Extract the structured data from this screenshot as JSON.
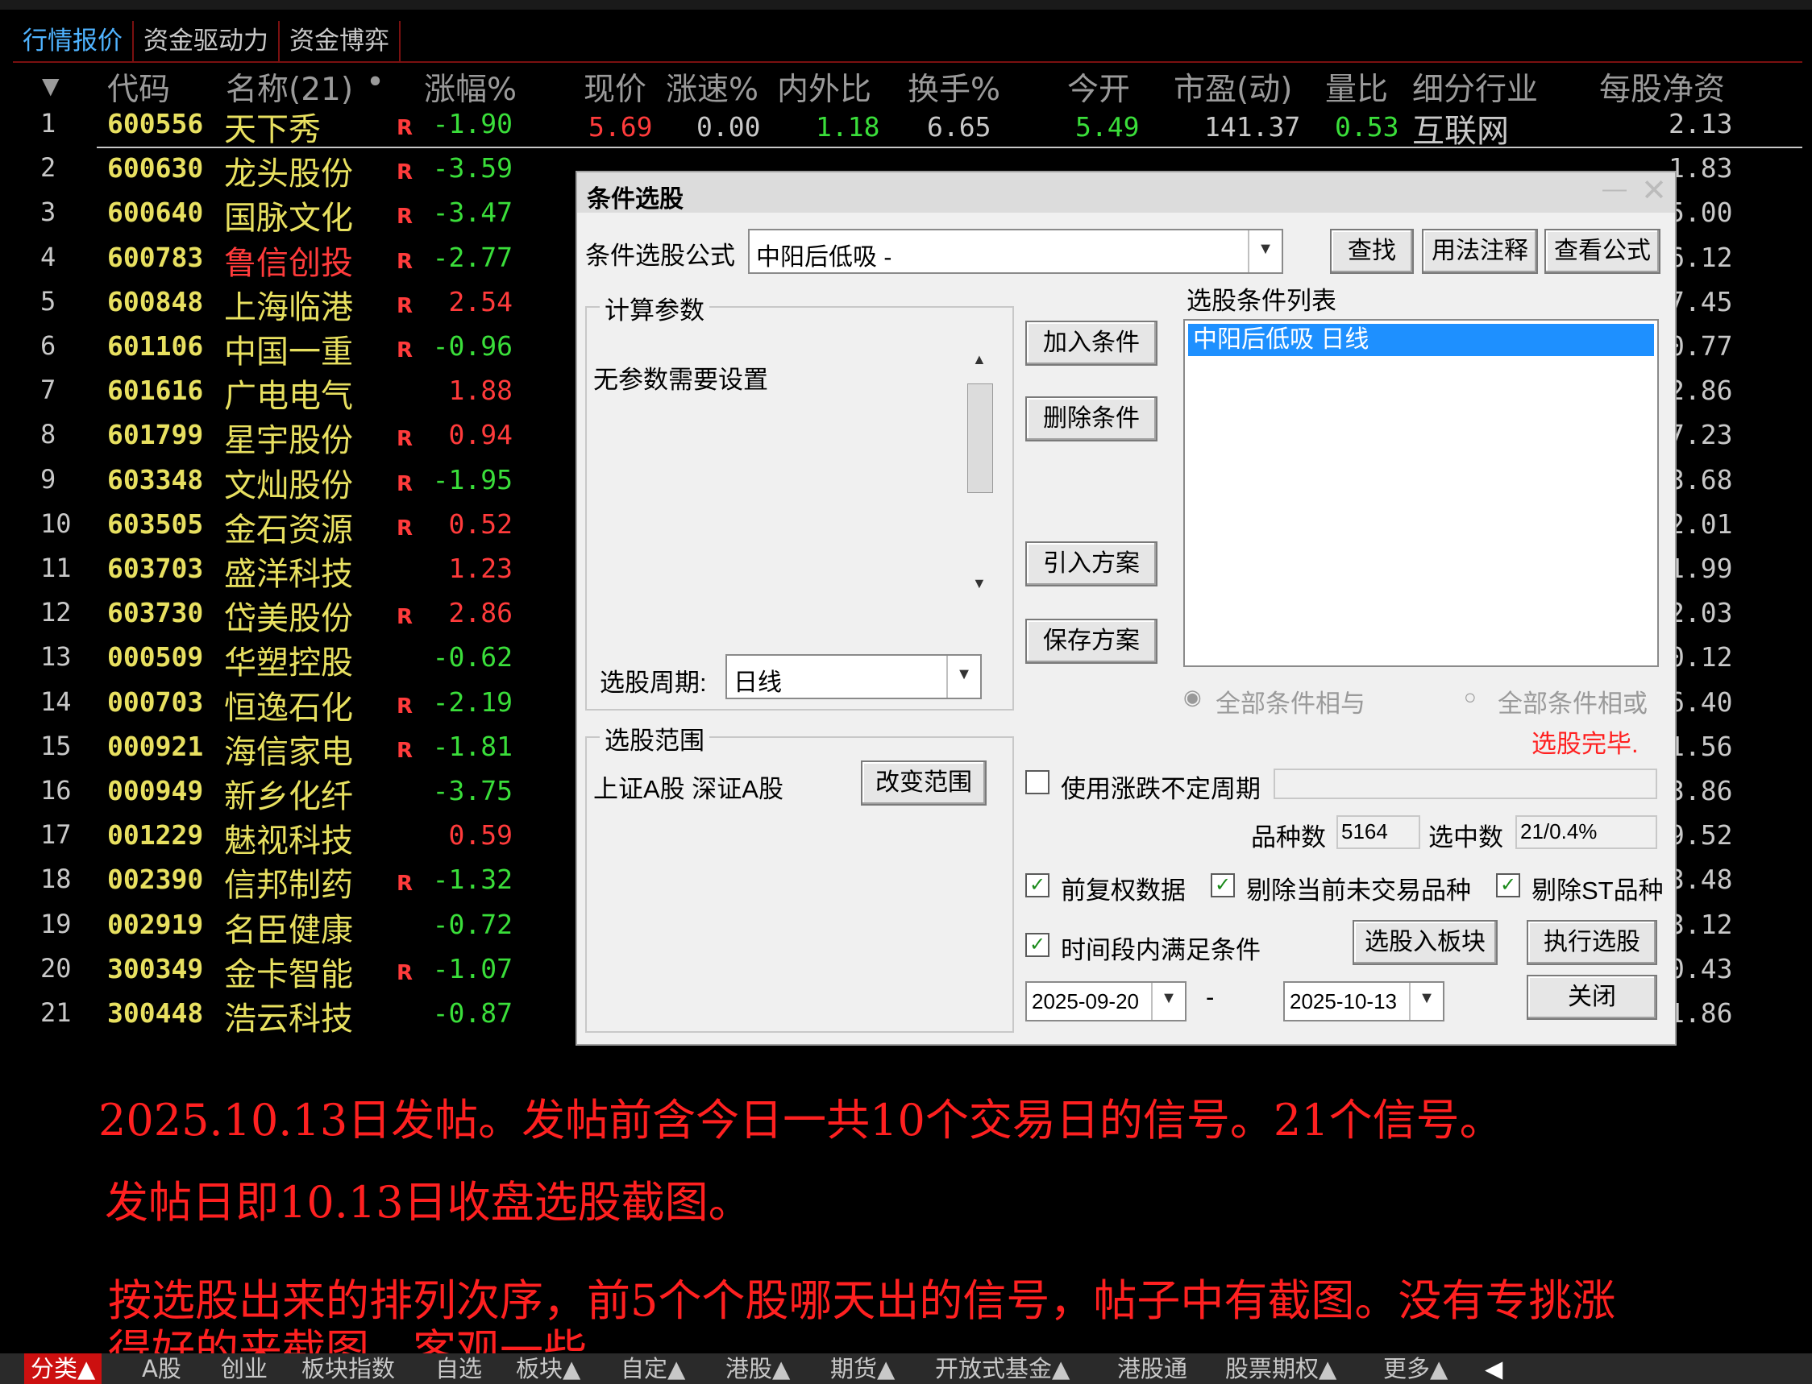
{
  "tabs": [
    "行情报价",
    "资金驱动力",
    "资金博弈"
  ],
  "columns": {
    "sort_icon": "▼",
    "code": "代码",
    "name": "名称(21)",
    "dot": "•",
    "change": "涨幅%",
    "price": "现价",
    "speed": "涨速%",
    "inout": "内外比",
    "turnover": "换手%",
    "open": "今开",
    "pe": "市盈(动)",
    "volratio": "量比",
    "industry": "细分行业",
    "nav": "每股净资"
  },
  "first_row_extra": {
    "price": "5.69",
    "speed": "0.00",
    "inout": "1.18",
    "turnover": "6.65",
    "open": "5.49",
    "pe": "141.37",
    "volratio": "0.53",
    "industry": "互联网"
  },
  "rows": [
    {
      "n": "1",
      "code": "600556",
      "name": "天下秀",
      "r": "R",
      "pct": "-1.90",
      "nav": "2.13"
    },
    {
      "n": "2",
      "code": "600630",
      "name": "龙头股份",
      "r": "R",
      "pct": "-3.59",
      "nav": "1.83"
    },
    {
      "n": "3",
      "code": "600640",
      "name": "国脉文化",
      "r": "R",
      "pct": "-3.47",
      "nav": "5.00"
    },
    {
      "n": "4",
      "code": "600783",
      "name": "鲁信创投",
      "r": "R",
      "pct": "-2.77",
      "nav": "6.12"
    },
    {
      "n": "5",
      "code": "600848",
      "name": "上海临港",
      "r": "R",
      "pct": "2.54",
      "nav": "7.45"
    },
    {
      "n": "6",
      "code": "601106",
      "name": "中国一重",
      "r": "R",
      "pct": "-0.96",
      "nav": "0.77"
    },
    {
      "n": "7",
      "code": "601616",
      "name": "广电电气",
      "r": "",
      "pct": "1.88",
      "nav": "2.86"
    },
    {
      "n": "8",
      "code": "601799",
      "name": "星宇股份",
      "r": "R",
      "pct": "0.94",
      "nav": "7.23"
    },
    {
      "n": "9",
      "code": "603348",
      "name": "文灿股份",
      "r": "R",
      "pct": "-1.95",
      "nav": "3.68"
    },
    {
      "n": "10",
      "code": "603505",
      "name": "金石资源",
      "r": "R",
      "pct": "0.52",
      "nav": "2.01"
    },
    {
      "n": "11",
      "code": "603703",
      "name": "盛洋科技",
      "r": "",
      "pct": "1.23",
      "nav": "1.99"
    },
    {
      "n": "12",
      "code": "603730",
      "name": "岱美股份",
      "r": "R",
      "pct": "2.86",
      "nav": "2.03"
    },
    {
      "n": "13",
      "code": "000509",
      "name": "华塑控股",
      "r": "",
      "pct": "-0.62",
      "nav": "0.12"
    },
    {
      "n": "14",
      "code": "000703",
      "name": "恒逸石化",
      "r": "R",
      "pct": "-2.19",
      "nav": "6.40"
    },
    {
      "n": "15",
      "code": "000921",
      "name": "海信家电",
      "r": "R",
      "pct": "-1.81",
      "nav": "1.56"
    },
    {
      "n": "16",
      "code": "000949",
      "name": "新乡化纤",
      "r": "",
      "pct": "-3.75",
      "nav": "3.86"
    },
    {
      "n": "17",
      "code": "001229",
      "name": "魅视科技",
      "r": "",
      "pct": "0.59",
      "nav": "9.52"
    },
    {
      "n": "18",
      "code": "002390",
      "name": "信邦制药",
      "r": "R",
      "pct": "-1.32",
      "nav": "3.48"
    },
    {
      "n": "19",
      "code": "002919",
      "name": "名臣健康",
      "r": "",
      "pct": "-0.72",
      "nav": "3.12"
    },
    {
      "n": "20",
      "code": "300349",
      "name": "金卡智能",
      "r": "R",
      "pct": "-1.07",
      "nav": "0.43"
    },
    {
      "n": "21",
      "code": "300448",
      "name": "浩云科技",
      "r": "",
      "pct": "-0.87",
      "nav": "1.86"
    }
  ],
  "dialog": {
    "title": "条件选股",
    "formula_label": "条件选股公式",
    "formula_value": "中阳后低吸  -",
    "btn_find": "查找",
    "btn_usage": "用法注释",
    "btn_view": "查看公式",
    "params_title": "计算参数",
    "params_text": "无参数需要设置",
    "period_label": "选股周期:",
    "period_value": "日线",
    "btn_add": "加入条件",
    "btn_delete": "删除条件",
    "btn_import": "引入方案",
    "btn_save": "保存方案",
    "list_title": "选股条件列表",
    "list_items": [
      "中阳后低吸   日线"
    ],
    "radio_and": "全部条件相与",
    "radio_or": "全部条件相或",
    "status": "选股完毕.",
    "range_title": "选股范围",
    "range_text": "上证A股 深证A股",
    "btn_change_range": "改变范围",
    "chk_uncertain": "使用涨跌不定周期",
    "count_label": "品种数",
    "count_value": "5164",
    "selected_label": "选中数",
    "selected_value": "21/0.4%",
    "chk_adjust": "前复权数据",
    "chk_exclude_untraded": "剔除当前未交易品种",
    "chk_exclude_st": "剔除ST品种",
    "chk_period": "时间段内满足条件",
    "btn_to_block": "选股入板块",
    "btn_execute": "执行选股",
    "date_from": "2025-09-20",
    "date_sep": "-",
    "date_to": "2025-10-13",
    "btn_close": "关闭"
  },
  "messages": [
    "2025.10.13日发帖。发帖前含今日一共10个交易日的信号。21个信号。",
    "发帖日即10.13日收盘选股截图。",
    "按选股出来的排列次序，前5个个股哪天出的信号，帖子中有截图。没有专挑涨",
    "得好的来截图，客观一些。"
  ],
  "bottom_tabs": [
    "分类▲",
    "A股",
    "创业",
    "板块指数",
    "自选",
    "板块▲",
    "自定▲",
    "港股▲",
    "期货▲",
    "开放式基金▲",
    "港股通",
    "股票期权▲",
    "更多▲"
  ],
  "colors": {
    "accent_blue": "#4fb3ff",
    "up_red": "#ff3b3b",
    "down_green": "#3ade3a",
    "code_yellow": "#e8e060",
    "selection": "#1e90ff"
  }
}
